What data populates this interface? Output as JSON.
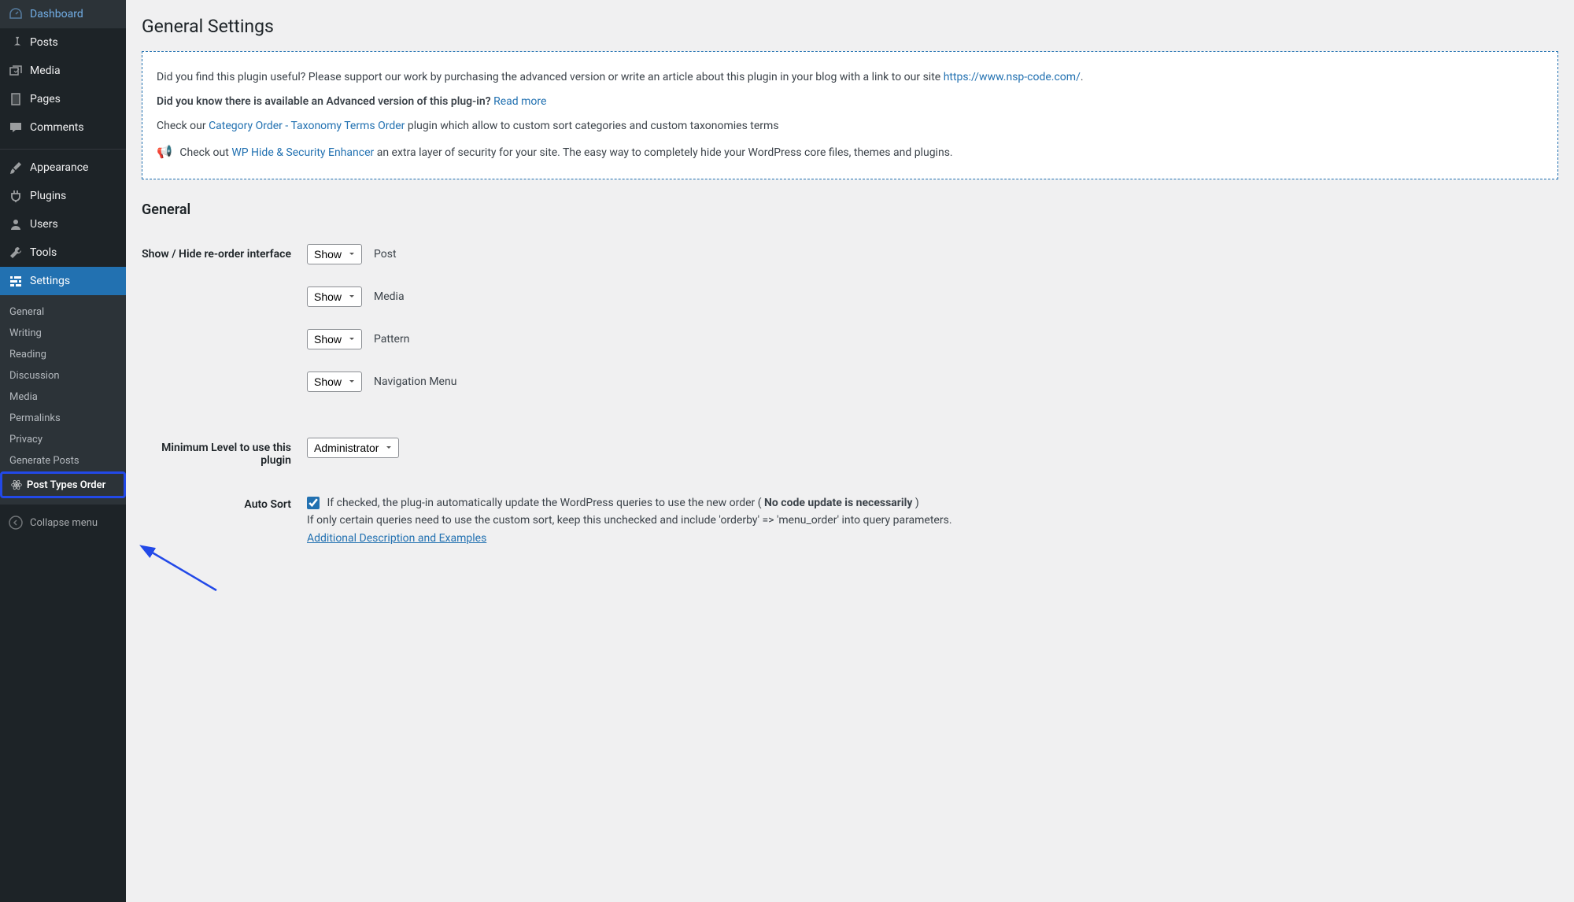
{
  "sidebar": {
    "main": [
      {
        "icon": "dashboard",
        "label": "Dashboard"
      },
      {
        "icon": "pin",
        "label": "Posts"
      },
      {
        "icon": "media",
        "label": "Media"
      },
      {
        "icon": "page",
        "label": "Pages"
      },
      {
        "icon": "comment",
        "label": "Comments"
      }
    ],
    "tools": [
      {
        "icon": "brush",
        "label": "Appearance"
      },
      {
        "icon": "plugin",
        "label": "Plugins"
      },
      {
        "icon": "user",
        "label": "Users"
      },
      {
        "icon": "wrench",
        "label": "Tools"
      },
      {
        "icon": "sliders",
        "label": "Settings",
        "current": true
      }
    ],
    "sub": [
      {
        "label": "General"
      },
      {
        "label": "Writing"
      },
      {
        "label": "Reading"
      },
      {
        "label": "Discussion"
      },
      {
        "label": "Media"
      },
      {
        "label": "Permalinks"
      },
      {
        "label": "Privacy"
      },
      {
        "label": "Generate Posts"
      },
      {
        "label": "Post Types Order",
        "highlight": true,
        "icon": "atom"
      }
    ],
    "collapse": "Collapse menu"
  },
  "page": {
    "title": "General Settings"
  },
  "notice": {
    "p1_a": "Did you find this plugin useful? Please support our work by purchasing the advanced version or write an article about this plugin in your blog with a link to our site ",
    "p1_link": "https://www.nsp-code.com/",
    "p1_b": ".",
    "p2_a": "Did you know there is available an Advanced version of this plug-in? ",
    "p2_link": "Read more",
    "p3_a": "Check our ",
    "p3_link": "Category Order - Taxonomy Terms Order",
    "p3_b": " plugin which allow to custom sort categories and custom taxonomies terms",
    "p4_a": "Check out ",
    "p4_link": "WP Hide & Security Enhancer",
    "p4_b": " an extra layer of security for your site. The easy way to completely hide your WordPress core files, themes and plugins."
  },
  "form": {
    "section": "General",
    "row1_label": "Show / Hide re-order interface",
    "selects": [
      {
        "value": "Show",
        "label": "Post"
      },
      {
        "value": "Show",
        "label": "Media"
      },
      {
        "value": "Show",
        "label": "Pattern"
      },
      {
        "value": "Show",
        "label": "Navigation Menu"
      }
    ],
    "row2_label": "Minimum Level to use this plugin",
    "row2_value": "Administrator",
    "row3_label": "Auto Sort",
    "row3_desc_a": "If checked, the plug-in automatically update the WordPress queries to use the new order ( ",
    "row3_desc_bold": "No code update is necessarily",
    "row3_desc_b": " )",
    "row3_desc2": "If only certain queries need to use the custom sort, keep this unchecked and include 'orderby' => 'menu_order' into query parameters.",
    "row3_link": "Additional Description and Examples"
  }
}
